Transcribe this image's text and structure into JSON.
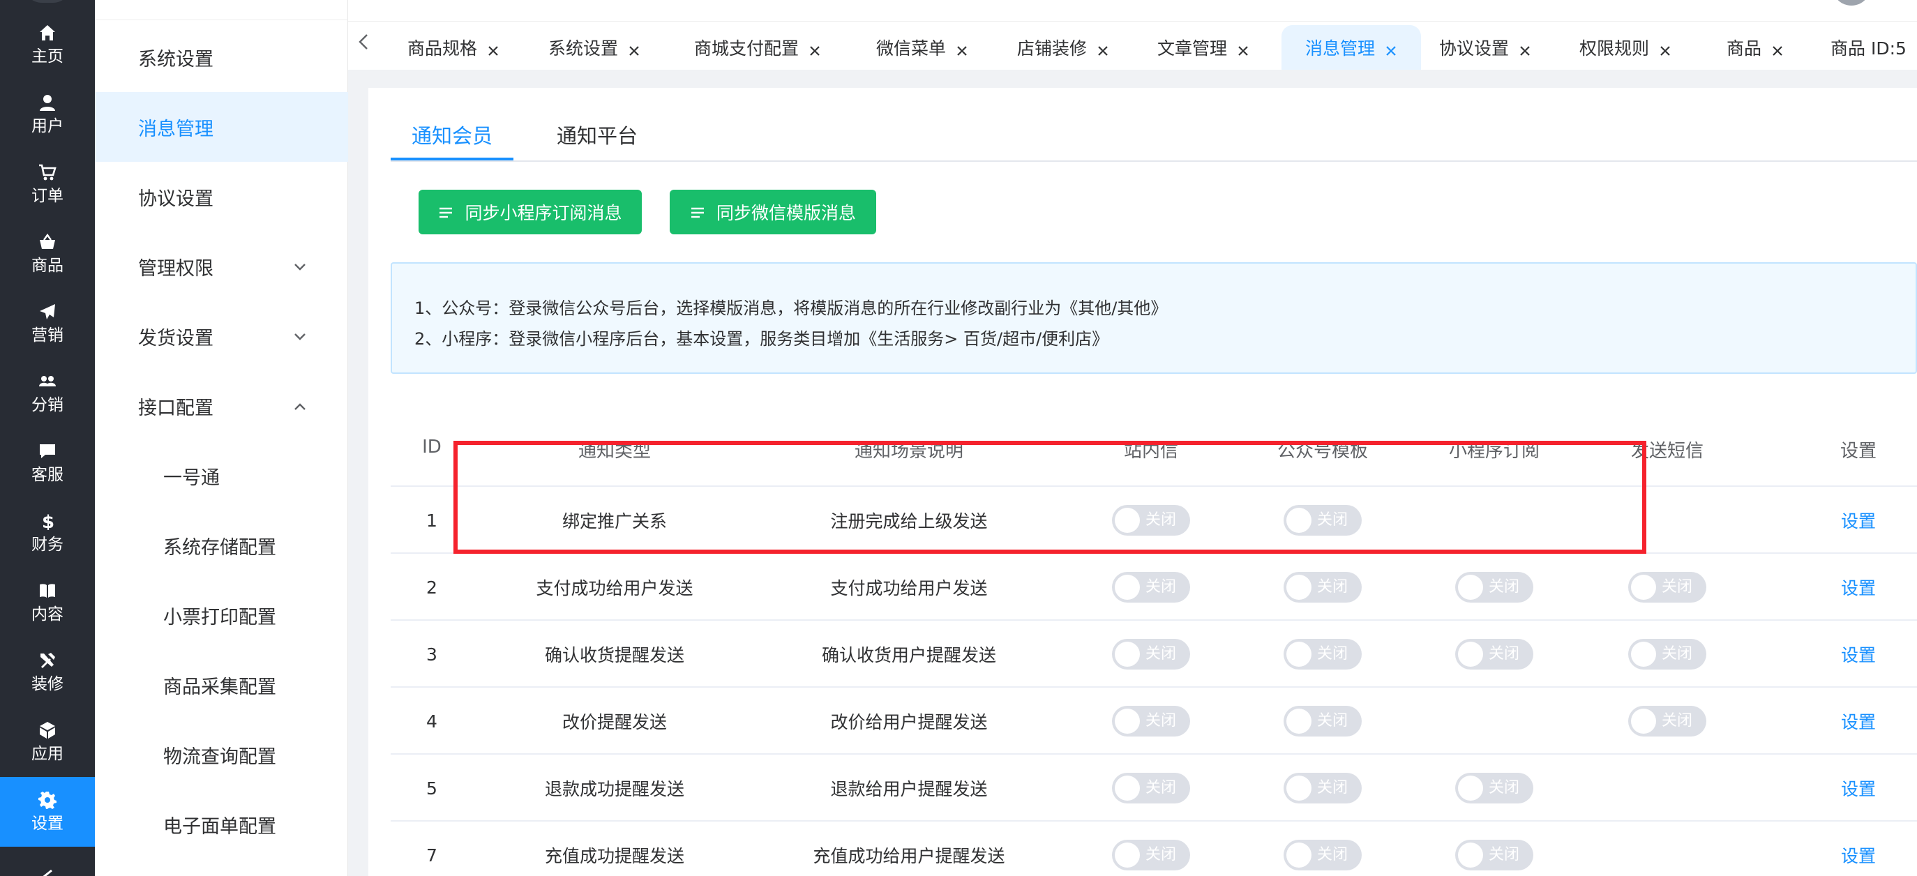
{
  "rail": {
    "items": [
      {
        "label": "主页",
        "icon": "home-icon"
      },
      {
        "label": "用户",
        "icon": "user-icon"
      },
      {
        "label": "订单",
        "icon": "cart-icon"
      },
      {
        "label": "商品",
        "icon": "basket-icon"
      },
      {
        "label": "营销",
        "icon": "paper-plane-icon"
      },
      {
        "label": "分销",
        "icon": "group-icon"
      },
      {
        "label": "客服",
        "icon": "chat-icon"
      },
      {
        "label": "财务",
        "icon": "dollar-icon"
      },
      {
        "label": "内容",
        "icon": "book-icon"
      },
      {
        "label": "装修",
        "icon": "tools-icon"
      },
      {
        "label": "应用",
        "icon": "cube-icon"
      },
      {
        "label": "设置",
        "icon": "gear-icon",
        "active": true
      }
    ]
  },
  "submenu": {
    "items": [
      {
        "label": "系统设置",
        "level": 1
      },
      {
        "label": "消息管理",
        "level": 1,
        "active": true
      },
      {
        "label": "协议设置",
        "level": 1
      },
      {
        "label": "管理权限",
        "level": 1,
        "chevron": "down"
      },
      {
        "label": "发货设置",
        "level": 1,
        "chevron": "down"
      },
      {
        "label": "接口配置",
        "level": 1,
        "chevron": "up"
      },
      {
        "label": "一号通",
        "level": 2
      },
      {
        "label": "系统存储配置",
        "level": 2
      },
      {
        "label": "小票打印配置",
        "level": 2
      },
      {
        "label": "商品采集配置",
        "level": 2
      },
      {
        "label": "物流查询配置",
        "level": 2
      },
      {
        "label": "电子面单配置",
        "level": 2
      }
    ]
  },
  "tabs": {
    "items": [
      {
        "label": "商品规格",
        "closable": true
      },
      {
        "label": "系统设置",
        "closable": true
      },
      {
        "label": "商城支付配置",
        "closable": true
      },
      {
        "label": "微信菜单",
        "closable": true
      },
      {
        "label": "店铺装修",
        "closable": true
      },
      {
        "label": "文章管理",
        "closable": true
      },
      {
        "label": "消息管理",
        "closable": true,
        "active": true
      },
      {
        "label": "协议设置",
        "closable": true
      },
      {
        "label": "权限规则",
        "closable": true
      },
      {
        "label": "商品",
        "closable": true
      },
      {
        "label": "商品 ID:5",
        "closable": false
      }
    ]
  },
  "panel": {
    "subtabs": [
      "通知会员",
      "通知平台"
    ],
    "buttons": {
      "sync_mini": "同步小程序订阅消息",
      "sync_wechat": "同步微信模版消息"
    },
    "notice": {
      "line1": "1、公众号：登录微信公众号后台，选择模版消息，将模版消息的所在行业修改副行业为《其他/其他》",
      "line2": "2、小程序：登录微信小程序后台，基本设置，服务类目增加《生活服务> 百货/超市/便利店》"
    }
  },
  "table": {
    "headers": [
      "ID",
      "通知类型",
      "通知场景说明",
      "站内信",
      "公众号模板",
      "小程序订阅",
      "发送短信",
      "设置"
    ],
    "switch_off_label": "关闭",
    "action_label": "设置",
    "rows": [
      {
        "id": "1",
        "type": "绑定推广关系",
        "scene": "注册完成给上级发送",
        "station": true,
        "official": true,
        "mini": false,
        "sms": false
      },
      {
        "id": "2",
        "type": "支付成功给用户发送",
        "scene": "支付成功给用户发送",
        "station": true,
        "official": true,
        "mini": true,
        "sms": true
      },
      {
        "id": "3",
        "type": "确认收货提醒发送",
        "scene": "确认收货用户提醒发送",
        "station": true,
        "official": true,
        "mini": true,
        "sms": true
      },
      {
        "id": "4",
        "type": "改价提醒发送",
        "scene": "改价给用户提醒发送",
        "station": true,
        "official": true,
        "mini": false,
        "sms": true
      },
      {
        "id": "5",
        "type": "退款成功提醒发送",
        "scene": "退款给用户提醒发送",
        "station": true,
        "official": true,
        "mini": true,
        "sms": false
      },
      {
        "id": "7",
        "type": "充值成功提醒发送",
        "scene": "充值成功给用户提醒发送",
        "station": true,
        "official": true,
        "mini": true,
        "sms": false
      }
    ]
  },
  "colors": {
    "rail_bg": "#282c34",
    "accent": "#1890ff",
    "green": "#19be6b",
    "highlight": "#f5222d"
  }
}
